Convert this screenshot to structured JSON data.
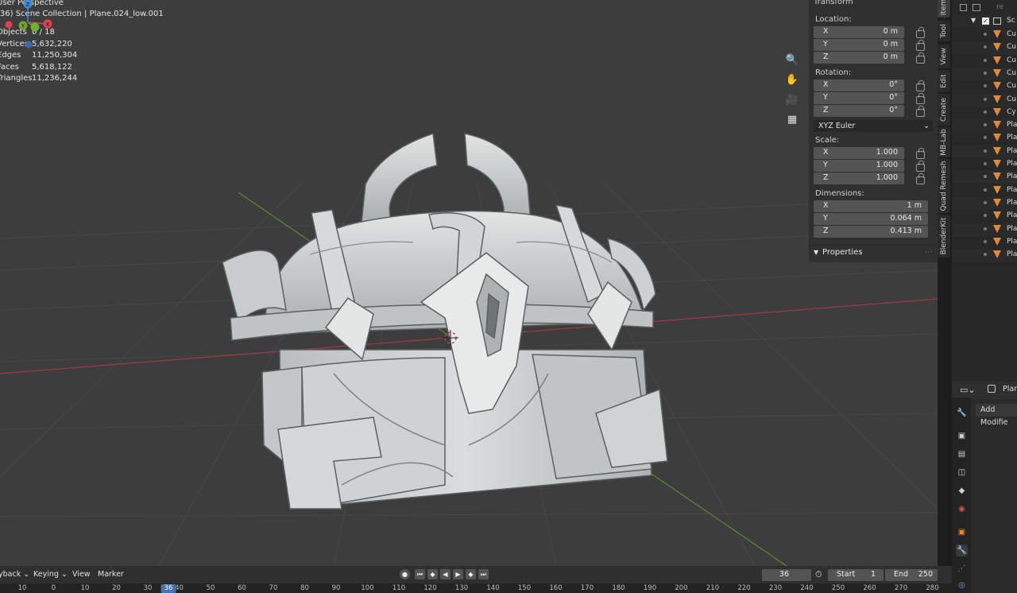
{
  "viewport": {
    "view_name": "User Perspective",
    "collection_path": "(36) Scene Collection | Plane.024_low.001",
    "stats": [
      {
        "label": "Objects",
        "value": "0 / 18"
      },
      {
        "label": "Vertices",
        "value": "5,632,220"
      },
      {
        "label": "Edges",
        "value": "11,250,304"
      },
      {
        "label": "Faces",
        "value": "5,618,122"
      },
      {
        "label": "Triangles",
        "value": "11,236,244"
      }
    ],
    "gizmo": {
      "z": "Z",
      "y": "Y",
      "x": "X"
    }
  },
  "npanel": {
    "section_title": "Transform",
    "location": {
      "label": "Location:",
      "x": "0 m",
      "y": "0 m",
      "z": "0 m"
    },
    "rotation": {
      "label": "Rotation:",
      "x": "0°",
      "y": "0°",
      "z": "0°"
    },
    "rotation_mode": "XYZ Euler",
    "scale": {
      "label": "Scale:",
      "x": "1.000",
      "y": "1.000",
      "z": "1.000"
    },
    "dimensions": {
      "label": "Dimensions:",
      "x": "1 m",
      "y": "0.064 m",
      "z": "0.413 m"
    },
    "axis_x": "X",
    "axis_y": "Y",
    "axis_z": "Z",
    "properties_title": "Properties",
    "tabs": [
      "Item",
      "Tool",
      "View",
      "Edit",
      "Create",
      "MB-Lab",
      "Quad Remesh",
      "BlenderKit"
    ]
  },
  "outliner": {
    "top_label": "re",
    "collection_label": "Sc",
    "items": [
      "Cu",
      "Cu",
      "Cu",
      "Cu",
      "Cu",
      "Cu",
      "Cy",
      "Pla",
      "Pla",
      "Pla",
      "Pla",
      "Pla",
      "Pla",
      "Pla",
      "Pla",
      "Pla",
      "Pla",
      "Pla"
    ]
  },
  "properties": {
    "object_name": "Plan",
    "add_modifier": "Add Modifie"
  },
  "timeline": {
    "playback_label": "yback",
    "keying_label": "Keying",
    "view_label": "View",
    "marker_label": "Marker",
    "current_frame": "36",
    "start_label": "Start",
    "start_value": "1",
    "end_label": "End",
    "end_value": "250",
    "ruler_ticks": [
      "10",
      "0",
      "10",
      "20",
      "30",
      "40",
      "50",
      "60",
      "70",
      "80",
      "90",
      "100",
      "110",
      "120",
      "130",
      "140",
      "150",
      "160",
      "170",
      "180",
      "190",
      "200",
      "210",
      "220",
      "230",
      "240",
      "250",
      "260",
      "270",
      "280"
    ],
    "ruler_current": "36"
  },
  "colors": {
    "accent": "#4772b3",
    "object_icon": "#e08a35",
    "axis_x": "#e04050",
    "axis_y": "#70b030",
    "axis_z": "#3a8ee0"
  }
}
